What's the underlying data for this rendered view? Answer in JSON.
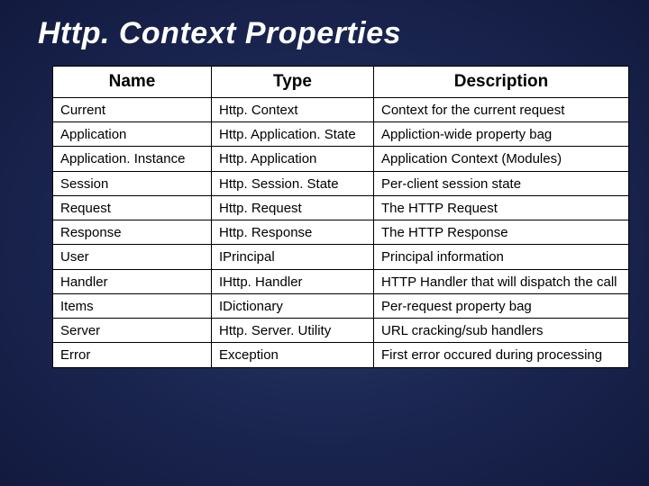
{
  "title": "Http. Context Properties",
  "headers": [
    "Name",
    "Type",
    "Description"
  ],
  "rows": [
    {
      "name": "Current",
      "type": "Http. Context",
      "desc": "Context for the current request"
    },
    {
      "name": "Application",
      "type": "Http. Application. State",
      "desc": "Appliction-wide property bag"
    },
    {
      "name": "Application. Instance",
      "type": "Http. Application",
      "desc": "Application Context (Modules)"
    },
    {
      "name": "Session",
      "type": "Http. Session. State",
      "desc": "Per-client session state"
    },
    {
      "name": "Request",
      "type": "Http. Request",
      "desc": "The HTTP Request"
    },
    {
      "name": "Response",
      "type": "Http. Response",
      "desc": "The HTTP Response"
    },
    {
      "name": "User",
      "type": "IPrincipal",
      "desc": "Principal information"
    },
    {
      "name": "Handler",
      "type": "IHttp. Handler",
      "desc": "HTTP Handler that will dispatch the call"
    },
    {
      "name": "Items",
      "type": "IDictionary",
      "desc": "Per-request property bag"
    },
    {
      "name": "Server",
      "type": "Http. Server. Utility",
      "desc": "URL cracking/sub handlers"
    },
    {
      "name": "Error",
      "type": "Exception",
      "desc": "First error occured during processing"
    }
  ]
}
